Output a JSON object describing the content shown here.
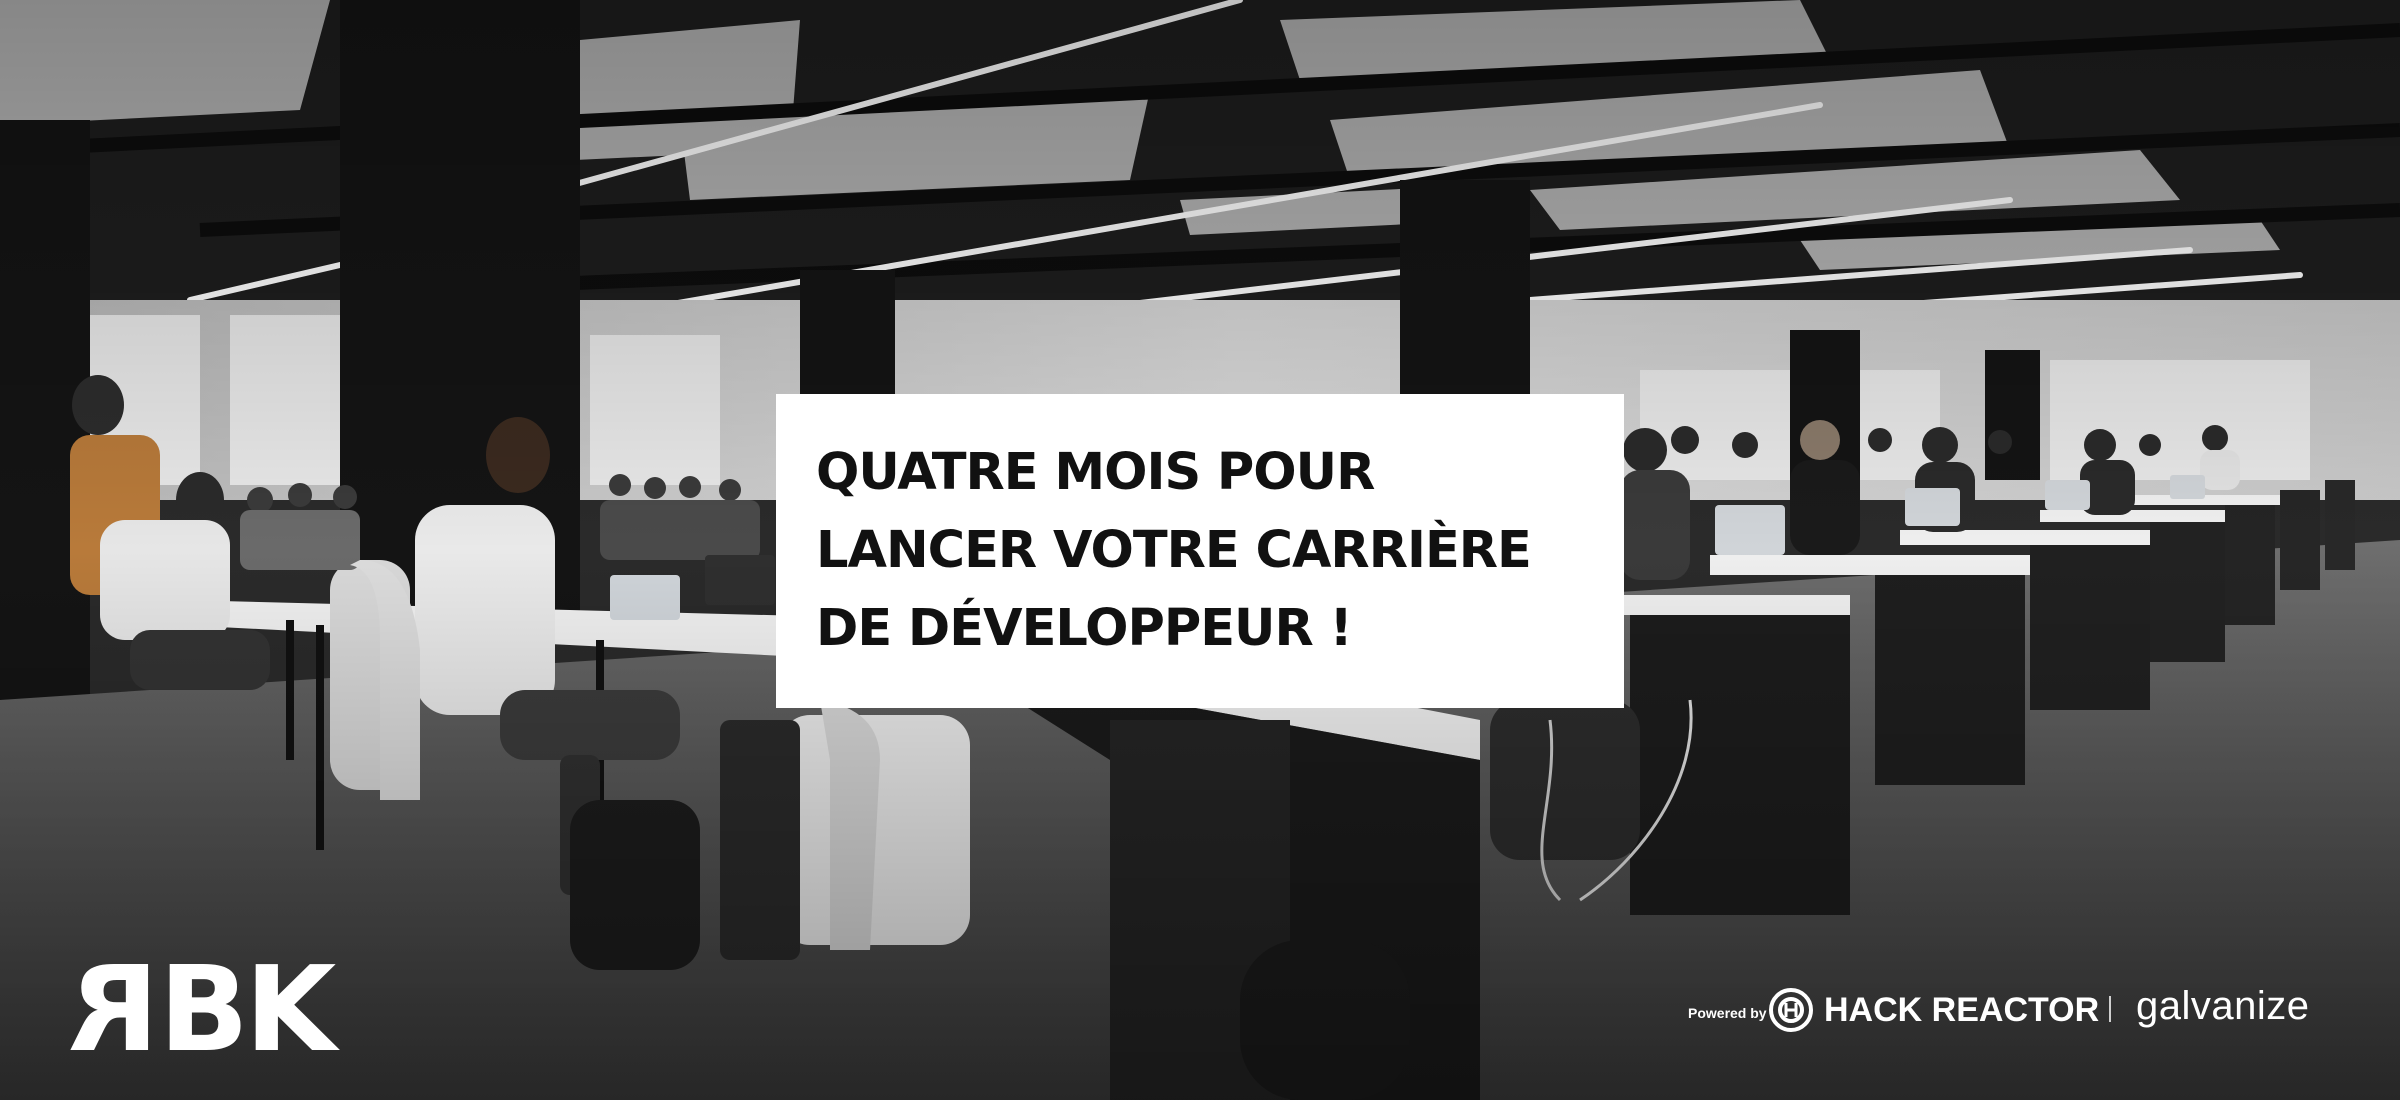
{
  "headline": {
    "line1": "QUATRE MOIS POUR",
    "line2": "LANCER VOTRE CARRIÈRE",
    "line3": "DE DÉVELOPPEUR !"
  },
  "logo": {
    "mirrored_letter": "R",
    "rest": "BK"
  },
  "partners": {
    "powered_by": "Powered by",
    "hack_reactor": "HACK REACTOR",
    "galvanize": "galvanize"
  },
  "icons": [
    "hack-reactor-logo-icon",
    "arrow-icon"
  ],
  "colors": {
    "headline_bg": "#ffffff",
    "headline_text": "#111111",
    "logo": "#ffffff"
  }
}
